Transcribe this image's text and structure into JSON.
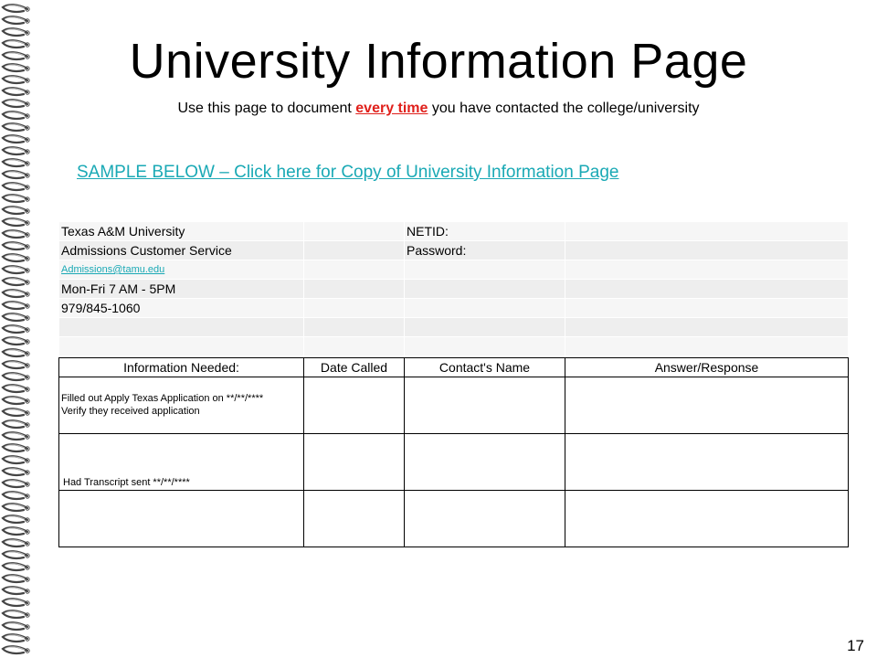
{
  "title": "University Information Page",
  "subtitle": {
    "before": "Use this page to document ",
    "emphasis": "every time",
    "after": " you have contacted the college/university"
  },
  "sample_link": "SAMPLE BELOW – Click here for Copy of University Information Page",
  "info": {
    "university": "Texas A&M University",
    "netid_label": "NETID:",
    "department": "Admissions Customer Service",
    "password_label": "Password:",
    "email": "Admissions@tamu.edu",
    "hours": "Mon-Fri  7 AM - 5PM",
    "phone": "979/845-1060"
  },
  "log": {
    "headers": [
      "Information Needed:",
      "Date Called",
      "Contact's Name",
      "Answer/Response"
    ],
    "rows": [
      {
        "info_line1": "Filled out Apply Texas Application on **/**/****",
        "info_line2": "Verify they received application"
      },
      {
        "info_line1": "Had Transcript sent **/**/****"
      },
      {
        "info_line1": ""
      }
    ]
  },
  "page_number": "17",
  "colors": {
    "link": "#1aa9b5",
    "emphasis": "#e0201b"
  }
}
